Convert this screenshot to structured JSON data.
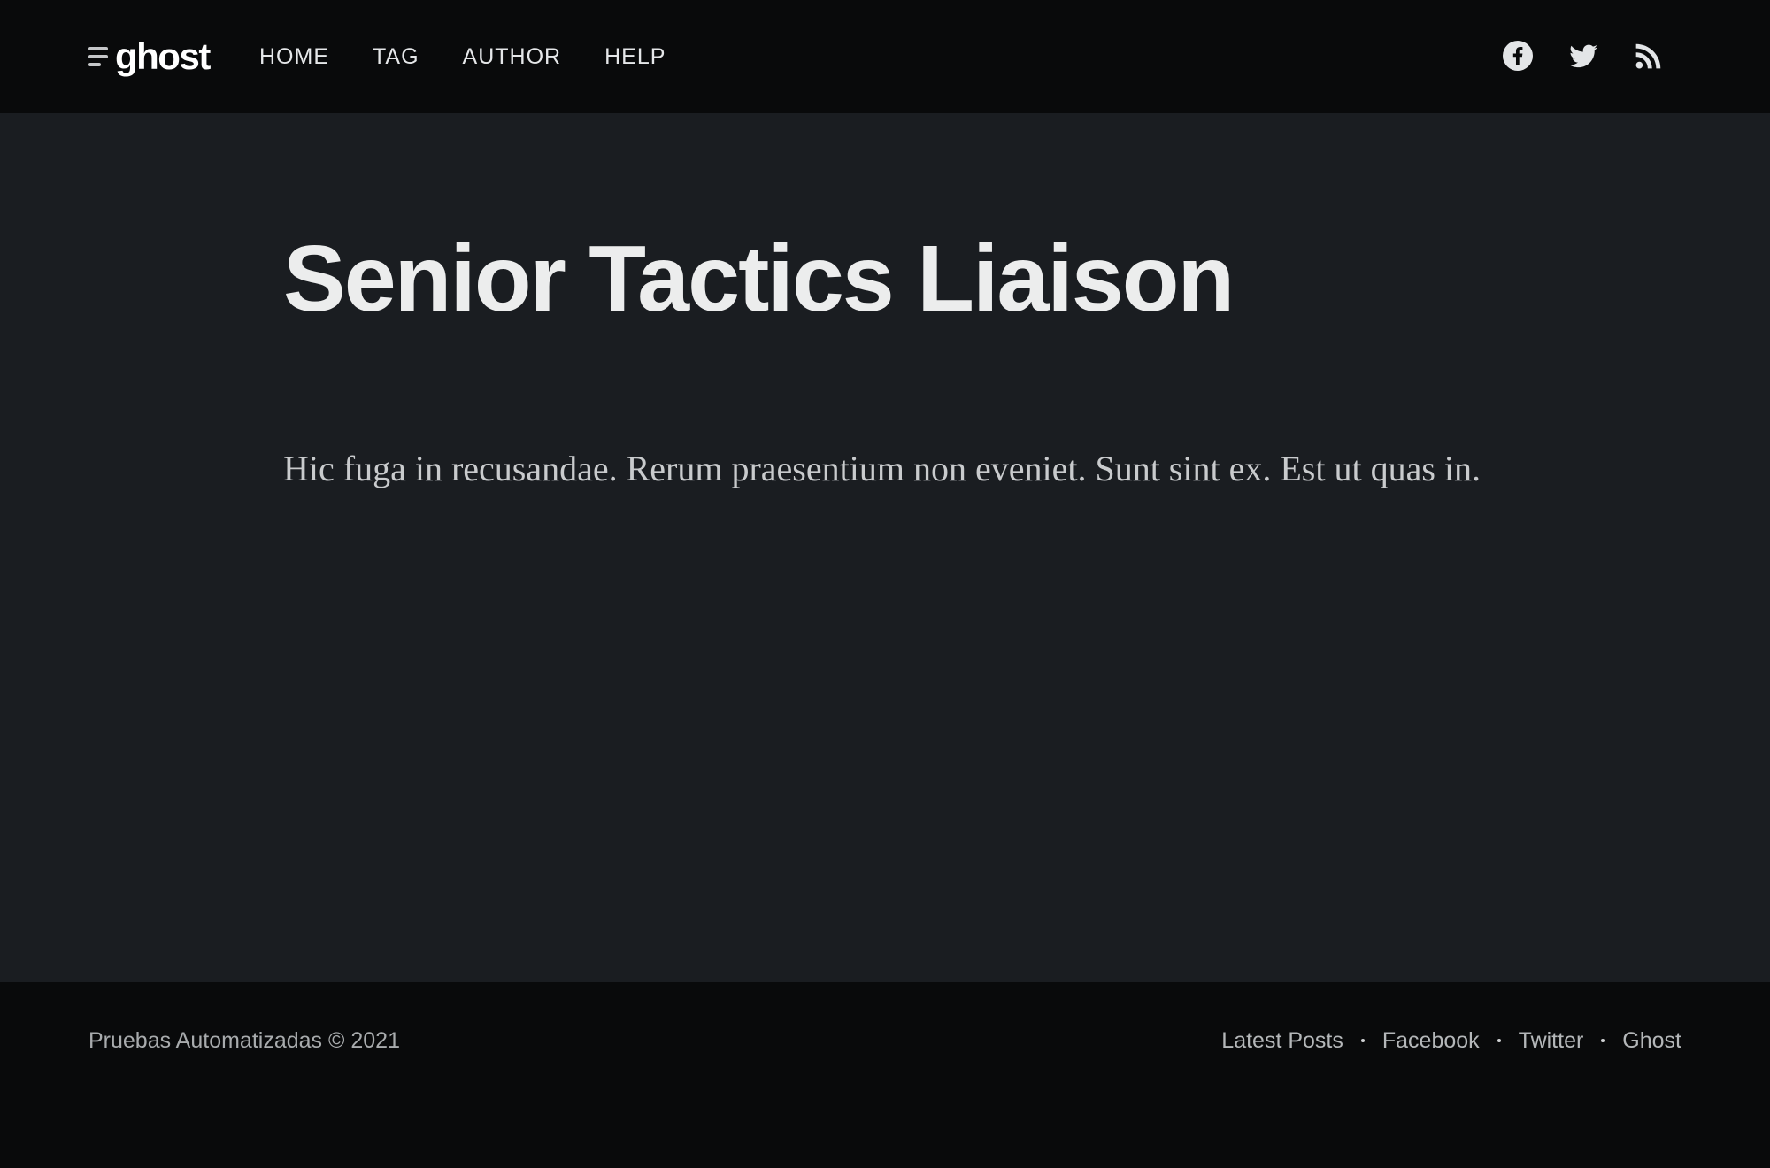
{
  "header": {
    "logo_text": "ghost",
    "nav": [
      "HOME",
      "TAG",
      "AUTHOR",
      "HELP"
    ],
    "social_icons": [
      "facebook-icon",
      "twitter-icon",
      "rss-icon"
    ]
  },
  "post": {
    "title": "Senior Tactics Liaison",
    "content": "Hic fuga in recusandae. Rerum praesentium non eveniet. Sunt sint ex. Est ut quas in."
  },
  "footer": {
    "copyright": "Pruebas Automatizadas © 2021",
    "links": [
      "Latest Posts",
      "Facebook",
      "Twitter",
      "Ghost"
    ]
  },
  "colors": {
    "header_bg": "#090a0b",
    "main_bg": "#1a1d21",
    "title": "#eceded",
    "body_text": "#c9cbcd"
  }
}
